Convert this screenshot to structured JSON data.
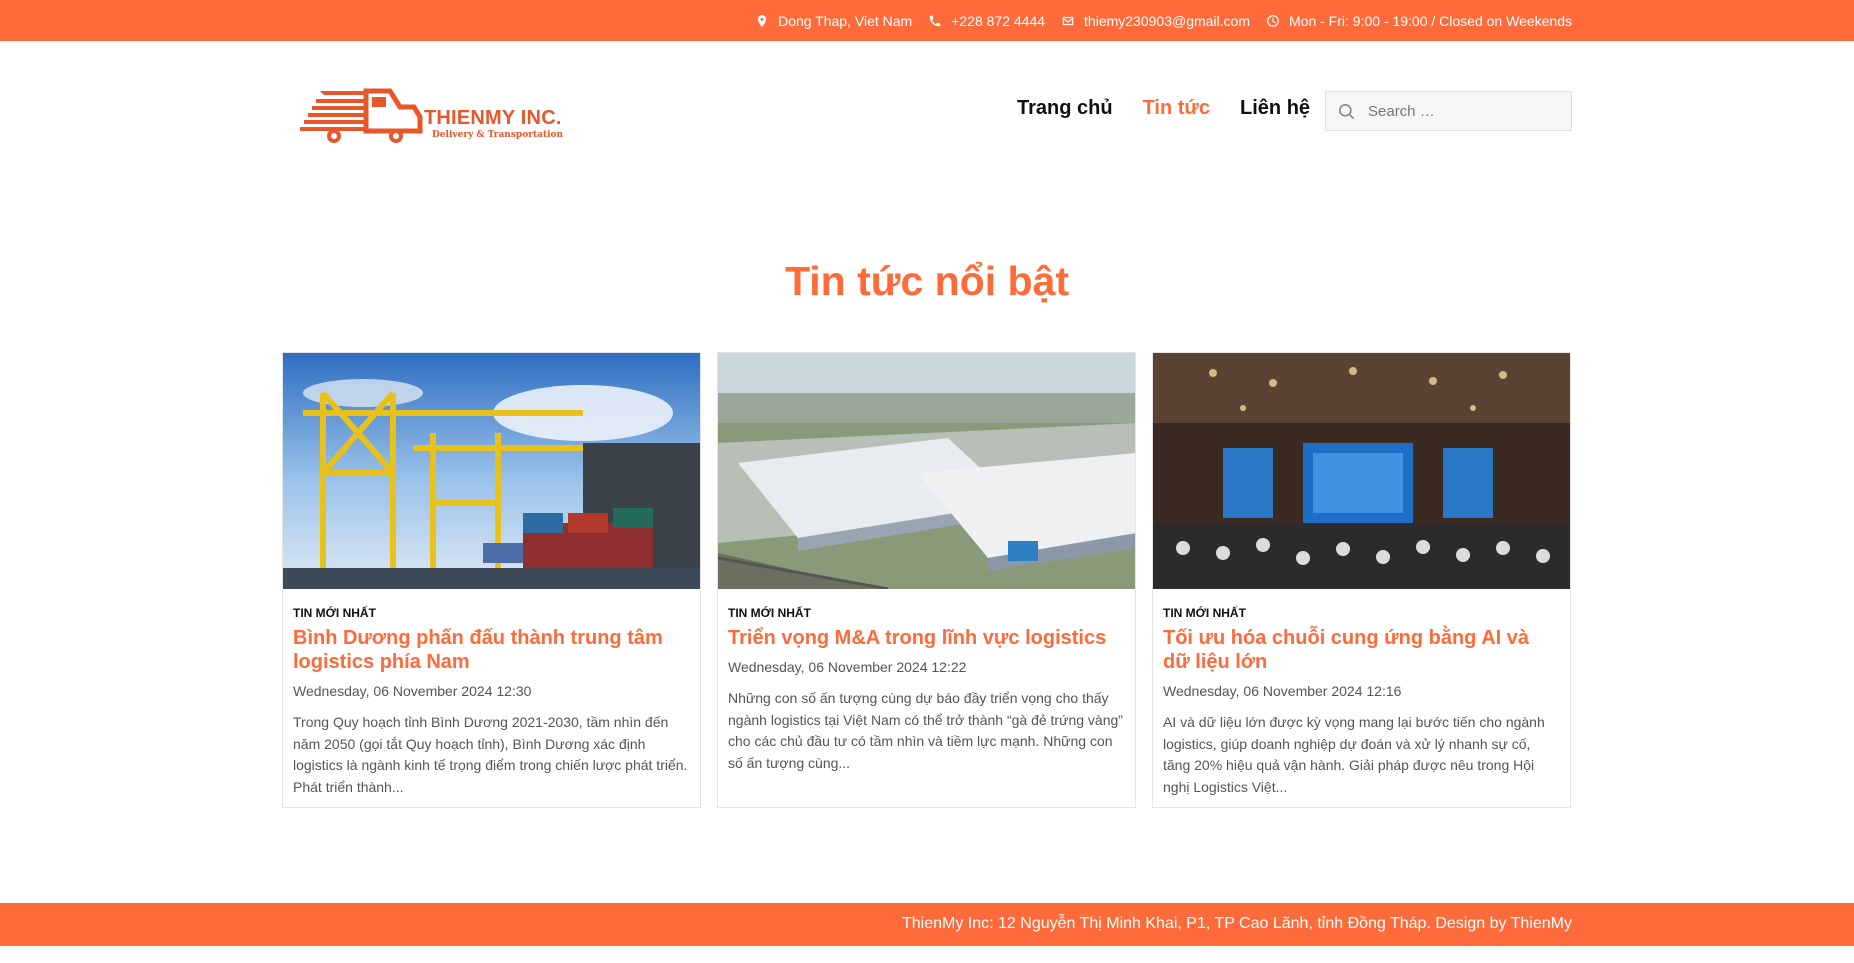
{
  "topbar": {
    "location": "Dong Thap, Viet Nam",
    "phone": "+228 872 4444",
    "email": "thiemy230903@gmail.com",
    "hours": "Mon - Fri: 9:00 - 19:00 / Closed on Weekends"
  },
  "logo": {
    "name": "THIENMY INC.",
    "tagline": "Delivery & Transportation"
  },
  "nav": {
    "items": [
      {
        "label": "Trang chủ"
      },
      {
        "label": "Tin tức"
      },
      {
        "label": "Liên hệ"
      }
    ],
    "active_index": 1
  },
  "search": {
    "placeholder": "Search …"
  },
  "section": {
    "title": "Tin tức nổi bật"
  },
  "posts": [
    {
      "category": "Tin mới nhất",
      "title": "Bình Dương phấn đấu thành trung tâm logistics phía Nam",
      "date": "Wednesday, 06 November 2024 12:30",
      "excerpt": "Trong Quy hoạch tỉnh Bình Dương 2021-2030, tầm nhìn đến năm 2050 (gọi tắt Quy hoạch tỉnh), Bình Dương xác định logistics là ngành kinh tế trọng điểm trong chiến lược phát triển. Phát triển thành...",
      "image": "port-cranes-photo"
    },
    {
      "category": "Tin mới nhất",
      "title": "Triển vọng M&A trong lĩnh vực logistics",
      "date": "Wednesday, 06 November 2024 12:22",
      "excerpt": "Những con số ấn tượng cùng dự báo đầy triển vọng cho thấy ngành logistics tại Việt Nam có thể trở thành “gà đẻ trứng vàng” cho các chủ đầu tư có tầm nhìn và tiềm lực mạnh. Những con số ấn tượng cùng...",
      "image": "warehouse-aerial-photo"
    },
    {
      "category": "Tin mới nhất",
      "title": "Tối ưu hóa chuỗi cung ứng bằng AI và dữ liệu lớn",
      "date": "Wednesday, 06 November 2024 12:16",
      "excerpt": "AI và dữ liệu lớn được kỳ vọng mang lại bước tiến cho ngành logistics, giúp doanh nghiệp dự đoán và xử lý nhanh sự cố, tăng 20% hiệu quả vận hành. Giải pháp được nêu trong Hội nghị Logistics Việt...",
      "image": "conference-hall-photo"
    }
  ],
  "footer": {
    "text": "ThienMy Inc: 12 Nguyễn Thị Minh Khai, P1, TP Cao Lãnh, tỉnh Đồng Tháp. Design by ThienMy"
  },
  "colors": {
    "accent": "#fd6b3b",
    "text_dark": "#111111",
    "text_muted": "#555555"
  }
}
